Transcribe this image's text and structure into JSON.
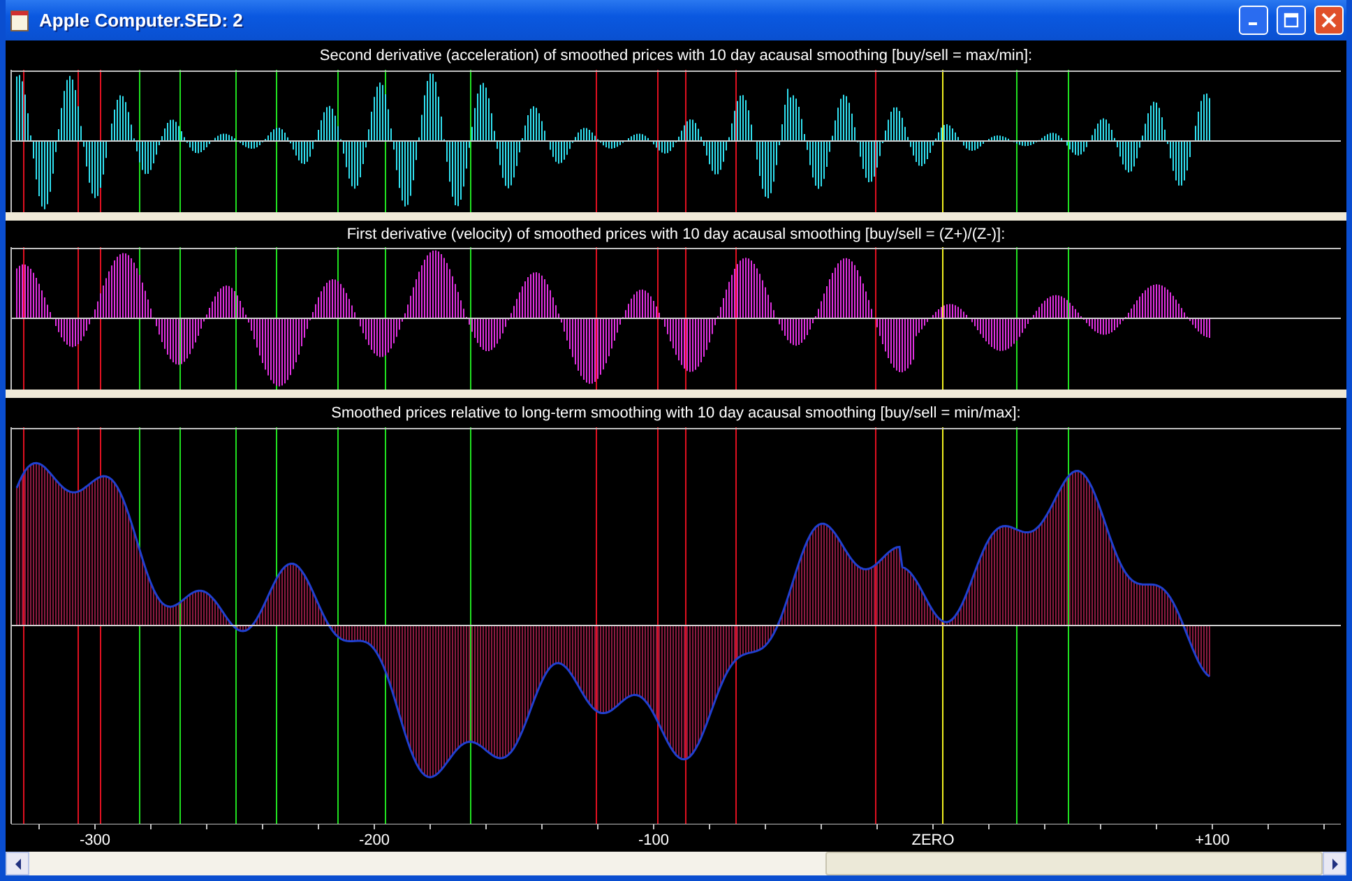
{
  "window": {
    "title": "Apple Computer.SED: 2"
  },
  "panels": [
    {
      "kind": "acceleration",
      "title": "Second derivative (acceleration) of smoothed prices with 10 day acausal smoothing [buy/sell = max/min]:"
    },
    {
      "kind": "velocity",
      "title": "First derivative (velocity) of smoothed prices with 10 day acausal smoothing [buy/sell = (Z+)/(Z-)]:"
    },
    {
      "kind": "relative",
      "title": "Smoothed prices relative to long-term smoothing with 10 day acausal smoothing [buy/sell = min/max]:"
    }
  ],
  "axis_labels": [
    "-300",
    "-200",
    "-100",
    "ZERO",
    "+100"
  ]
}
